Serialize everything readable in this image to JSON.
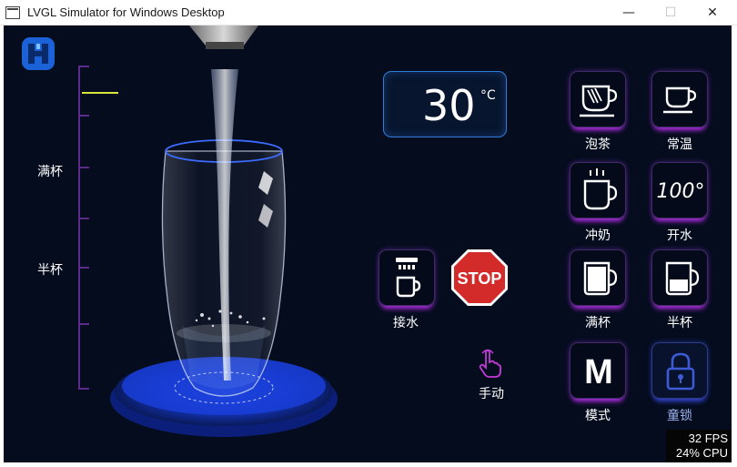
{
  "window": {
    "title": "LVGL Simulator for Windows Desktop",
    "minimize_glyph": "—",
    "maximize_glyph": "☐",
    "close_glyph": "✕"
  },
  "scale": {
    "full_label": "满杯",
    "half_label": "半杯"
  },
  "temperature": {
    "value": "30",
    "unit": "°C"
  },
  "actions": {
    "water_label": "接水",
    "manual_label": "手动"
  },
  "modes": [
    {
      "label": "泡茶",
      "icon": "tea-cup-icon"
    },
    {
      "label": "常温",
      "icon": "cup-icon"
    },
    {
      "label": "冲奶",
      "icon": "hot-mug-icon"
    },
    {
      "label": "开水",
      "icon": "boiling-100-icon"
    },
    {
      "label": "满杯",
      "icon": "full-cup-icon"
    },
    {
      "label": "半杯",
      "icon": "half-cup-icon"
    },
    {
      "label": "模式",
      "icon": "m-mode-icon"
    },
    {
      "label": "童锁",
      "icon": "lock-icon"
    }
  ],
  "icon_text": {
    "boiling": "100°",
    "mode": "M",
    "stop": "STOP"
  },
  "perf": {
    "fps": "32 FPS",
    "cpu": "24% CPU"
  },
  "colors": {
    "background": "#050c1e",
    "button_glow": "#b02ce0",
    "temp_border": "#2f7dd9",
    "stop_red": "#d32a2a",
    "level_mark": "#d8e63c"
  }
}
